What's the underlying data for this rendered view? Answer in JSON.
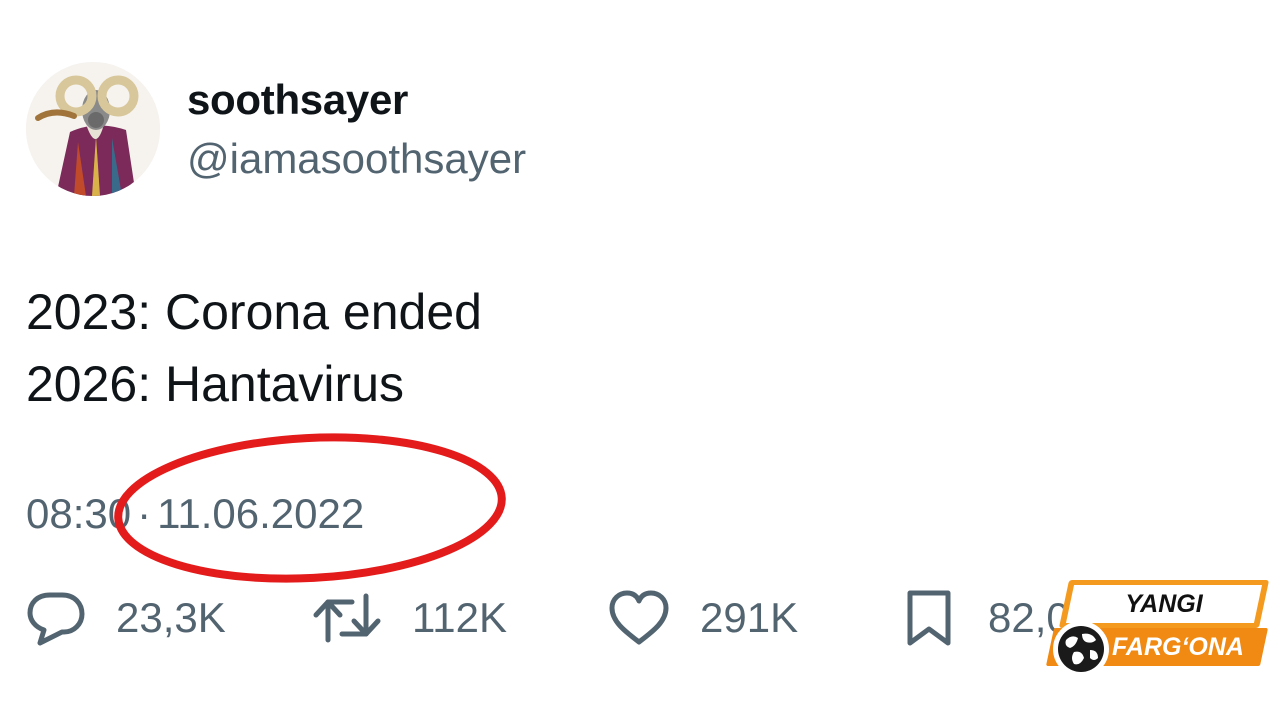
{
  "author": {
    "display_name": "soothsayer",
    "handle": "@iamasoothsayer",
    "avatar_icon": "ram-character-avatar"
  },
  "tweet": {
    "lines": [
      "2023: Corona ended",
      "2026: Hantavirus"
    ]
  },
  "timestamp": {
    "time": "08:30",
    "separator": "·",
    "date": "11.06.2022"
  },
  "highlight": {
    "color": "#e31b1b"
  },
  "actions": {
    "reply": {
      "icon": "reply-icon",
      "count": "23,3K"
    },
    "retweet": {
      "icon": "retweet-icon",
      "count": "112K"
    },
    "like": {
      "icon": "heart-icon",
      "count": "291K"
    },
    "bookmark": {
      "icon": "bookmark-icon",
      "count": "82,0"
    }
  },
  "watermark": {
    "top_text": "YANGI",
    "bottom_text": "FARG‘ONA",
    "accent": "#f08a12"
  },
  "colors": {
    "text_primary": "#0f1419",
    "text_secondary": "#536471"
  }
}
